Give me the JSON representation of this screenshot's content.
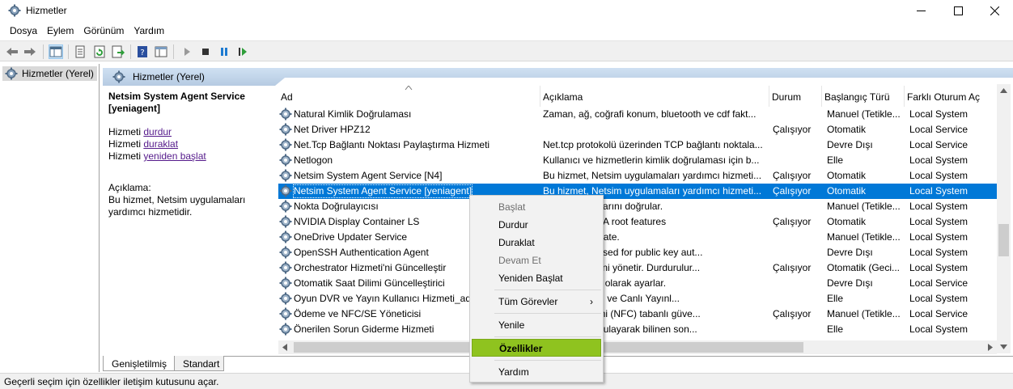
{
  "window": {
    "title": "Hizmetler"
  },
  "menu": [
    "Dosya",
    "Eylem",
    "Görünüm",
    "Yardım"
  ],
  "tree": {
    "root_label": "Hizmetler (Yerel)"
  },
  "main_header": {
    "label": "Hizmetler (Yerel)"
  },
  "details": {
    "service_name": "Netsim System Agent Service [yeniagent]",
    "actions": [
      {
        "prefix": "Hizmeti ",
        "link": "durdur"
      },
      {
        "prefix": "Hizmeti ",
        "link": "duraklat"
      },
      {
        "prefix": "Hizmeti ",
        "link": "yeniden başlat"
      }
    ],
    "description_label": "Açıklama:",
    "description_text": "Bu hizmet, Netsim uygulamaları yardımcı hizmetidir."
  },
  "columns": [
    "Ad",
    "Açıklama",
    "Durum",
    "Başlangıç Türü",
    "Farklı Oturum Aç"
  ],
  "rows": [
    {
      "name": "Natural Kimlik Doğrulaması",
      "desc": "Zaman, ağ, coğrafi konum, bluetooth ve cdf fakt...",
      "status": "",
      "start": "Manuel (Tetikle...",
      "logon": "Local System"
    },
    {
      "name": "Net Driver HPZ12",
      "desc": "",
      "status": "Çalışıyor",
      "start": "Otomatik",
      "logon": "Local Service"
    },
    {
      "name": "Net.Tcp Bağlantı Noktası Paylaştırma Hizmeti",
      "desc": "Net.tcp protokolü üzerinden TCP bağlantı noktala...",
      "status": "",
      "start": "Devre Dışı",
      "logon": "Local Service"
    },
    {
      "name": "Netlogon",
      "desc": "Kullanıcı ve hizmetlerin kimlik doğrulaması için b...",
      "status": "",
      "start": "Elle",
      "logon": "Local System"
    },
    {
      "name": "Netsim System Agent Service [N4]",
      "desc": "Bu hizmet, Netsim uygulamaları yardımcı hizmeti...",
      "status": "Çalışıyor",
      "start": "Otomatik",
      "logon": "Local System"
    },
    {
      "name": "Netsim System Agent Service [yeniagent]",
      "desc": "Bu hizmet, Netsim uygulamaları yardımcı hizmeti...",
      "status": "Çalışıyor",
      "start": "Otomatik",
      "logon": "Local System",
      "selected": true
    },
    {
      "name": "Nokta Doğrulayıcısı",
      "desc": "temi bozulmalarını doğrular.",
      "status": "",
      "start": "Manuel (Tetikle...",
      "logon": "Local System"
    },
    {
      "name": "NVIDIA Display Container LS",
      "desc": "vice for NVIDIA root features",
      "status": "Çalışıyor",
      "start": "Otomatik",
      "logon": "Local System"
    },
    {
      "name": "OneDrive Updater Service",
      "desc": "eDrive up to date.",
      "status": "",
      "start": "Manuel (Tetikle...",
      "logon": "Local System"
    },
    {
      "name": "OpenSSH Authentication Agent",
      "desc": "private keys used for public key aut...",
      "status": "",
      "start": "Devre Dışı",
      "logon": "Local System"
    },
    {
      "name": "Orchestrator Hizmeti'ni Güncelleştir",
      "desc": "celleştirmelerini yönetir. Durdurulur...",
      "status": "Çalışıyor",
      "start": "Otomatik (Geci...",
      "logon": "Local System"
    },
    {
      "name": "Otomatik Saat Dilimi Güncelleştirici",
      "desc": "imini otomatik olarak ayarlar.",
      "status": "",
      "start": "Devre Dışı",
      "logon": "Local Service"
    },
    {
      "name": "Oyun DVR ve Yayın Kullanıcı Hizmeti_ade",
      "desc": "Oyun Kayıtları ve Canlı Yayınl...",
      "status": "",
      "start": "Elle",
      "logon": "Local System"
    },
    {
      "name": "Ödeme ve NFC/SE Yöneticisi",
      "desc": "ın Alan İletişimi (NFC) tabanlı güve...",
      "status": "Çalışıyor",
      "start": "Manuel (Tetikle...",
      "logon": "Local Service"
    },
    {
      "name": "Önerilen Sorun Giderme Hizmeti",
      "desc": "gidermeyi uygulayarak bilinen son...",
      "status": "",
      "start": "Elle",
      "logon": "Local System"
    }
  ],
  "tabs": [
    "Genişletilmiş",
    "Standart"
  ],
  "status_bar": "Geçerli seçim için özellikler iletişim kutusunu açar.",
  "context_menu": [
    {
      "label": "Başlat",
      "disabled": true
    },
    {
      "label": "Durdur"
    },
    {
      "label": "Duraklat"
    },
    {
      "label": "Devam Et",
      "disabled": true
    },
    {
      "label": "Yeniden Başlat"
    },
    {
      "label": "Tüm Görevler",
      "submenu": true
    },
    {
      "label": "Yenile"
    },
    {
      "label": "Özellikler",
      "highlighted": true
    },
    {
      "label": "Yardım"
    }
  ],
  "colors": {
    "selection": "#0078d7",
    "menu_highlight": "#8fc31f",
    "link": "#551a8b"
  }
}
